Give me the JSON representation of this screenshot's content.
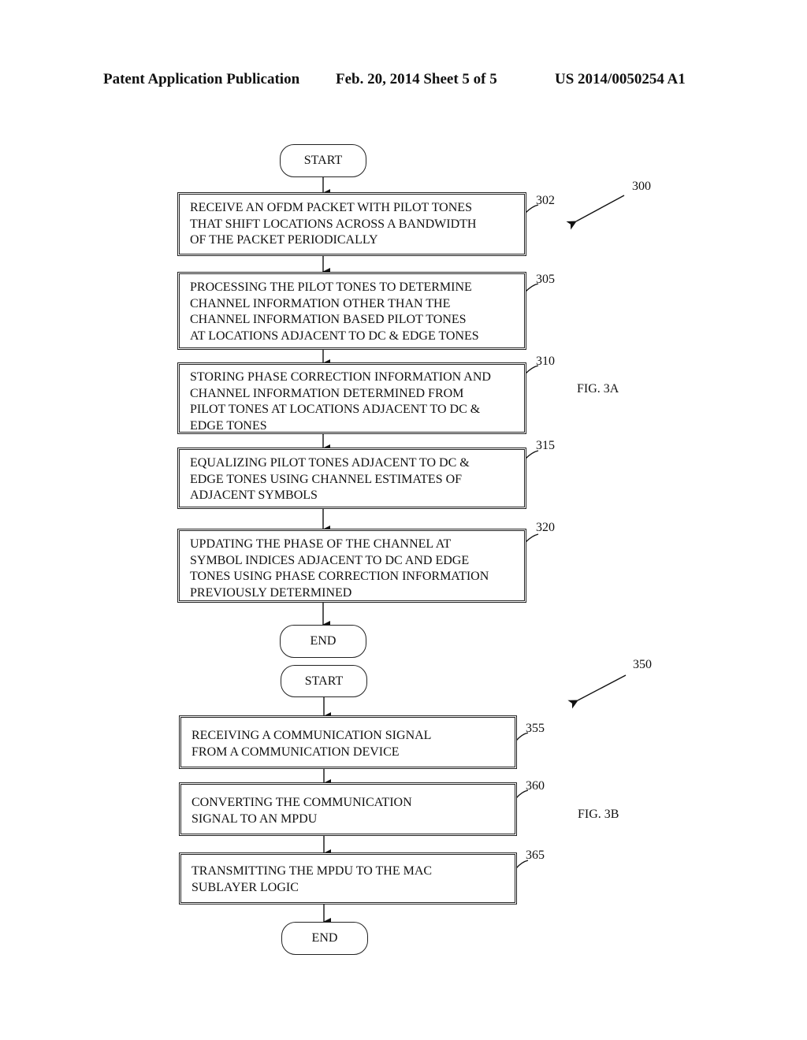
{
  "header": {
    "left": "Patent Application Publication",
    "middle": "Feb. 20, 2014   Sheet 5 of 5",
    "right": "US 2014/0050254 A1"
  },
  "fig3a": {
    "label": "FIG. 3A",
    "ref": "300",
    "start": "START",
    "end": "END",
    "steps": [
      {
        "ref": "302",
        "text": "RECEIVE AN OFDM PACKET WITH PILOT TONES\nTHAT SHIFT LOCATIONS ACROSS A BANDWIDTH\nOF THE PACKET PERIODICALLY"
      },
      {
        "ref": "305",
        "text": "PROCESSING THE PILOT TONES TO DETERMINE\nCHANNEL INFORMATION OTHER THAN THE\nCHANNEL INFORMATION BASED PILOT TONES\nAT LOCATIONS ADJACENT TO DC & EDGE TONES"
      },
      {
        "ref": "310",
        "text": "STORING PHASE CORRECTION INFORMATION AND\nCHANNEL INFORMATION DETERMINED FROM\nPILOT TONES AT LOCATIONS ADJACENT TO DC &\nEDGE TONES"
      },
      {
        "ref": "315",
        "text": "EQUALIZING PILOT TONES ADJACENT TO DC &\nEDGE TONES USING CHANNEL ESTIMATES OF\nADJACENT SYMBOLS"
      },
      {
        "ref": "320",
        "text": "UPDATING THE PHASE OF THE  CHANNEL AT\nSYMBOL INDICES ADJACENT TO DC AND EDGE\nTONES USING PHASE CORRECTION INFORMATION\nPREVIOUSLY DETERMINED"
      }
    ]
  },
  "fig3b": {
    "label": "FIG. 3B",
    "ref": "350",
    "start": "START",
    "end": "END",
    "steps": [
      {
        "ref": "355",
        "text": "RECEIVING A COMMUNICATION SIGNAL\nFROM A COMMUNICATION DEVICE"
      },
      {
        "ref": "360",
        "text": "CONVERTING THE COMMUNICATION\nSIGNAL TO AN MPDU"
      },
      {
        "ref": "365",
        "text": "TRANSMITTING THE MPDU TO THE MAC\nSUBLAYER LOGIC"
      }
    ]
  }
}
